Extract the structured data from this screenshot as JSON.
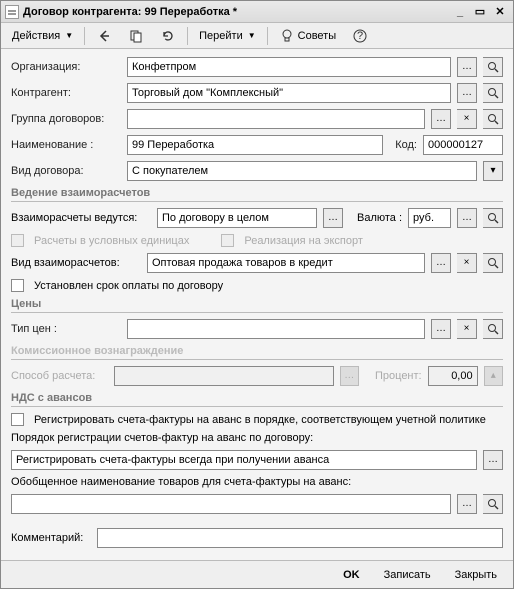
{
  "title": "Договор контрагента: 99 Переработка *",
  "toolbar": {
    "actions": "Действия",
    "go": "Перейти",
    "tips": "Советы"
  },
  "labels": {
    "org": "Организация:",
    "counterparty": "Контрагент:",
    "contract_group": "Группа договоров:",
    "name": "Наименование :",
    "code": "Код:",
    "contract_type": "Вид договора:"
  },
  "values": {
    "org": "Конфетпром",
    "counterparty": "Торговый дом \"Комплексный\"",
    "contract_group": "",
    "name": "99 Переработка",
    "code": "000000127",
    "contract_type": "С покупателем"
  },
  "settlements": {
    "title": "Ведение взаиморасчетов",
    "basis_label": "Взаиморасчеты ведутся:",
    "basis_value": "По договору в целом",
    "currency_label": "Валюта :",
    "currency_value": "руб.",
    "conv_units": "Расчеты в условных единицах",
    "export": "Реализация на экспорт",
    "type_label": "Вид взаиморасчетов:",
    "type_value": "Оптовая продажа товаров в кредит",
    "pay_term": "Установлен срок оплаты по договору"
  },
  "prices": {
    "title": "Цены",
    "type_label": "Тип цен :",
    "type_value": ""
  },
  "commission": {
    "title": "Комиссионное вознаграждение",
    "method_label": "Способ расчета:",
    "method_value": "",
    "percent_label": "Процент:",
    "percent_value": "0,00"
  },
  "vat": {
    "title": "НДС с авансов",
    "reg_policy": "Регистрировать счета-фактуры на аванс в порядке, соответствующем учетной политике",
    "order_label": "Порядок регистрации счетов-фактур на аванс по договору:",
    "order_value": "Регистрировать счета-фактуры всегда при получении аванса",
    "gen_name_label": "Обобщенное наименование товаров для счета-фактуры на аванс:",
    "gen_name_value": ""
  },
  "comment_label": "Комментарий:",
  "comment_value": "",
  "footer": {
    "ok": "OK",
    "save": "Записать",
    "close": "Закрыть"
  }
}
